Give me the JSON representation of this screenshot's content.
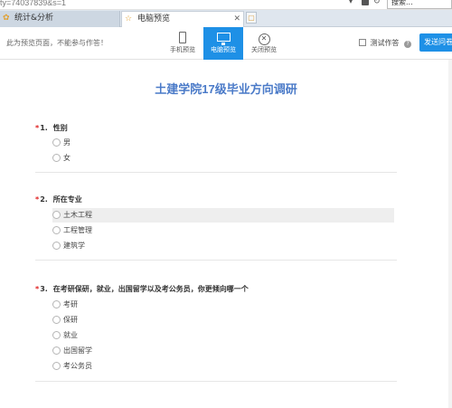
{
  "browser": {
    "address_text": "ty=74037839&s=1",
    "search_placeholder": "搜索...",
    "tabs": [
      {
        "label": "统计&分析"
      },
      {
        "label": "电脑预览",
        "close": "✕"
      }
    ]
  },
  "toolbar": {
    "notice": "此为预览页面，不能参与作答！",
    "mobile_label": "手机预览",
    "pc_label": "电脑预览",
    "close_label": "关闭预览",
    "test_label": "测试作答",
    "send_label": "发送问卷"
  },
  "survey": {
    "title": "土建学院17级毕业方向调研",
    "questions": [
      {
        "required": "*",
        "num": "1.",
        "text": "性别",
        "options": [
          "男",
          "女"
        ]
      },
      {
        "required": "*",
        "num": "2.",
        "text": "所在专业",
        "options": [
          "土木工程",
          "工程管理",
          "建筑学"
        ]
      },
      {
        "required": "*",
        "num": "3.",
        "text": "在考研保研，就业，出国留学以及考公务员，你更倾向哪一个",
        "options": [
          "考研",
          "保研",
          "就业",
          "出国留学",
          "考公务员"
        ]
      }
    ]
  },
  "colors": {
    "accent": "#1e90e6",
    "title": "#4a7ac8",
    "required": "#e02020"
  }
}
